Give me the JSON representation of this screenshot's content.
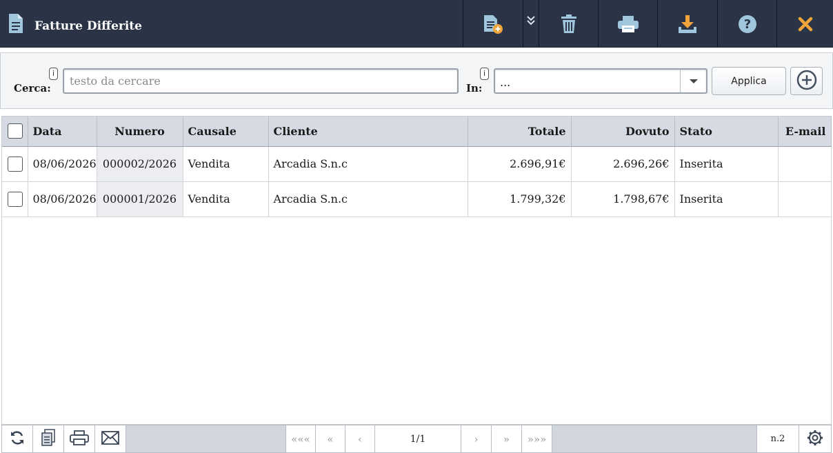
{
  "window": {
    "title": "Fatture Differite",
    "toolbar": {
      "new_icon": "new-document-icon",
      "more_icon": "double-chevron-down-icon",
      "delete_icon": "trash-icon",
      "print_icon": "printer-icon",
      "download_icon": "download-icon",
      "help_icon": "help-icon",
      "close_icon": "close-icon"
    }
  },
  "search": {
    "cerca_label": "Cerca:",
    "info_glyph": "i",
    "placeholder": "testo da cercare",
    "value": "",
    "in_label": "In:",
    "in_selected": "...",
    "apply_label": "Applica"
  },
  "table": {
    "columns": [
      "Data",
      "Numero",
      "Causale",
      "Cliente",
      "Totale",
      "Dovuto",
      "Stato",
      "E-mail"
    ],
    "rows": [
      {
        "data": "08/06/2026",
        "numero": "000002/2026",
        "causale": "Vendita",
        "cliente": "Arcadia S.n.c",
        "totale": "2.696,91€",
        "dovuto": "2.696,26€",
        "stato": "Inserita",
        "email": ""
      },
      {
        "data": "08/06/2026",
        "numero": "000001/2026",
        "causale": "Vendita",
        "cliente": "Arcadia S.n.c",
        "totale": "1.799,32€",
        "dovuto": "1.798,67€",
        "stato": "Inserita",
        "email": ""
      }
    ]
  },
  "pager": {
    "first": "«««",
    "prev_fast": "«",
    "prev": "‹",
    "page": "1/1",
    "next": "›",
    "next_fast": "»",
    "last": "»»»",
    "count": "n.2"
  },
  "colors": {
    "titlebar": "#2b3447",
    "icon_light": "#9fc6dc",
    "icon_orange": "#f0a43a"
  }
}
